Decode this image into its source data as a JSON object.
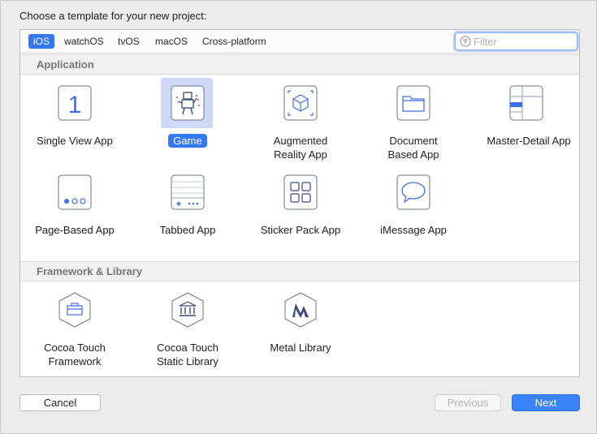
{
  "prompt": "Choose a template for your new project:",
  "platform_tabs": [
    {
      "label": "iOS",
      "active": true
    },
    {
      "label": "watchOS",
      "active": false
    },
    {
      "label": "tvOS",
      "active": false
    },
    {
      "label": "macOS",
      "active": false
    },
    {
      "label": "Cross-platform",
      "active": false
    }
  ],
  "search": {
    "placeholder": "Filter",
    "value": ""
  },
  "sections": [
    {
      "title": "Application",
      "items": [
        {
          "label": "Single View App",
          "icon": "single-view-app-icon",
          "selected": false
        },
        {
          "label": "Game",
          "icon": "game-icon",
          "selected": true
        },
        {
          "label": "Augmented\nReality App",
          "icon": "augmented-reality-icon",
          "selected": false
        },
        {
          "label": "Document\nBased App",
          "icon": "document-app-icon",
          "selected": false
        },
        {
          "label": "Master-Detail App",
          "icon": "master-detail-icon",
          "selected": false
        },
        {
          "label": "Page-Based App",
          "icon": "page-based-icon",
          "selected": false
        },
        {
          "label": "Tabbed App",
          "icon": "tabbed-app-icon",
          "selected": false
        },
        {
          "label": "Sticker Pack App",
          "icon": "sticker-pack-icon",
          "selected": false
        },
        {
          "label": "iMessage App",
          "icon": "imessage-app-icon",
          "selected": false
        }
      ]
    },
    {
      "title": "Framework & Library",
      "items": [
        {
          "label": "Cocoa Touch\nFramework",
          "icon": "framework-icon",
          "selected": false
        },
        {
          "label": "Cocoa Touch\nStatic Library",
          "icon": "static-library-icon",
          "selected": false
        },
        {
          "label": "Metal Library",
          "icon": "metal-library-icon",
          "selected": false
        }
      ]
    }
  ],
  "buttons": {
    "cancel": "Cancel",
    "previous": "Previous",
    "next": "Next"
  },
  "colors": {
    "accent": "#3478f6",
    "icon_stroke": "#4a5a8a",
    "selection_bg": "#cfd9f7"
  }
}
